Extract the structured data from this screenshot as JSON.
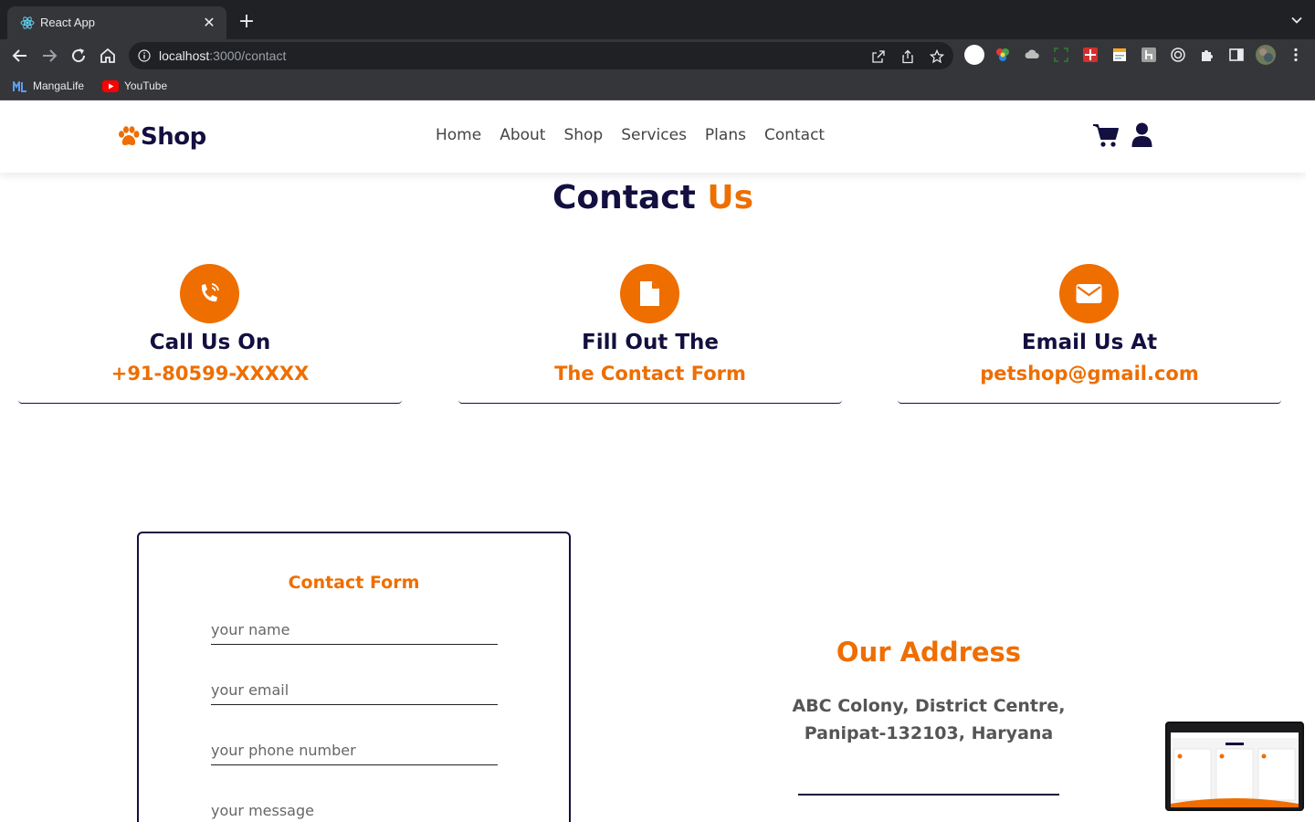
{
  "browser": {
    "tab_title": "React App",
    "url_host": "localhost",
    "url_path": ":3000/contact",
    "bookmarks": [
      {
        "label": "MangaLife"
      },
      {
        "label": "YouTube"
      }
    ]
  },
  "site": {
    "logo_text": "Shop",
    "nav": [
      "Home",
      "About",
      "Shop",
      "Services",
      "Plans",
      "Contact"
    ]
  },
  "contact": {
    "title_main": "Contact",
    "title_accent": "Us",
    "boxes": [
      {
        "icon": "phone-icon",
        "title": "Call Us On",
        "value": "+91-80599-XXXXX"
      },
      {
        "icon": "document-icon",
        "title": "Fill Out The",
        "value": "The Contact Form"
      },
      {
        "icon": "envelope-icon",
        "title": "Email Us At",
        "value": "petshop@gmail.com"
      }
    ]
  },
  "form": {
    "title": "Contact Form",
    "name_placeholder": "your name",
    "email_placeholder": "your email",
    "phone_placeholder": "your phone number",
    "message_placeholder": "your message"
  },
  "address": {
    "title": "Our Address",
    "line1": "ABC Colony, District Centre,",
    "line2": "Panipat-132103, Haryana"
  },
  "colors": {
    "accent": "#ee6e00",
    "navy": "#130f40",
    "chrome_dark": "#202124",
    "chrome_toolbar": "#35363a"
  }
}
